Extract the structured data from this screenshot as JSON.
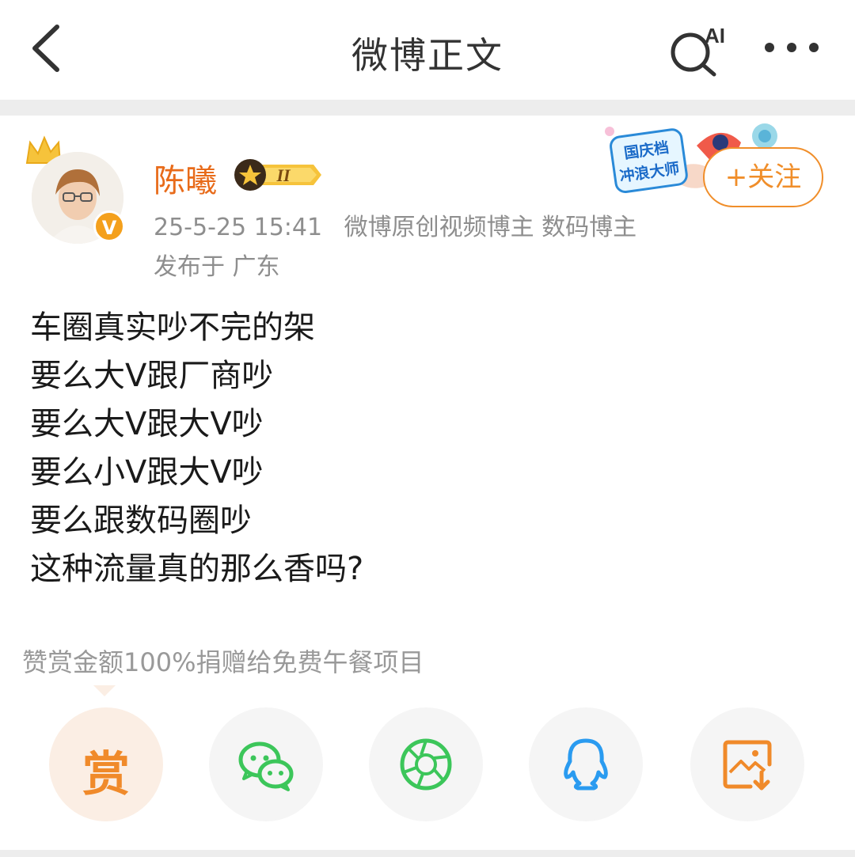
{
  "nav": {
    "title": "微博正文",
    "ai_label": "AI"
  },
  "author": {
    "name": "陈曦",
    "rank_label": "II",
    "time": "25-5-25 15:41",
    "tags": "微博原创视频博主 数码博主",
    "location": "发布于 广东",
    "verified_mark": "V"
  },
  "promo": {
    "line1": "国庆档",
    "line2": "冲浪大师"
  },
  "follow_label": "+关注",
  "post_lines": [
    "车圈真实吵不完的架",
    "要么大V跟厂商吵",
    "要么大V跟大V吵",
    "要么小V跟大V吵",
    "要么跟数码圈吵",
    "这种流量真的那么香吗?"
  ],
  "reward": {
    "note": "赞赏金额100%捐赠给免费午餐项目",
    "button_label": "赏"
  },
  "share_targets": [
    "wechat-icon",
    "moments-icon",
    "qq-icon",
    "save-image-icon"
  ],
  "colors": {
    "accent": "#f08e2a",
    "username": "#e86b1a",
    "meta": "#8e8e8e",
    "wechat": "#3cc65a",
    "qq": "#2a9bf0",
    "reward_bg": "#fbeee4"
  }
}
